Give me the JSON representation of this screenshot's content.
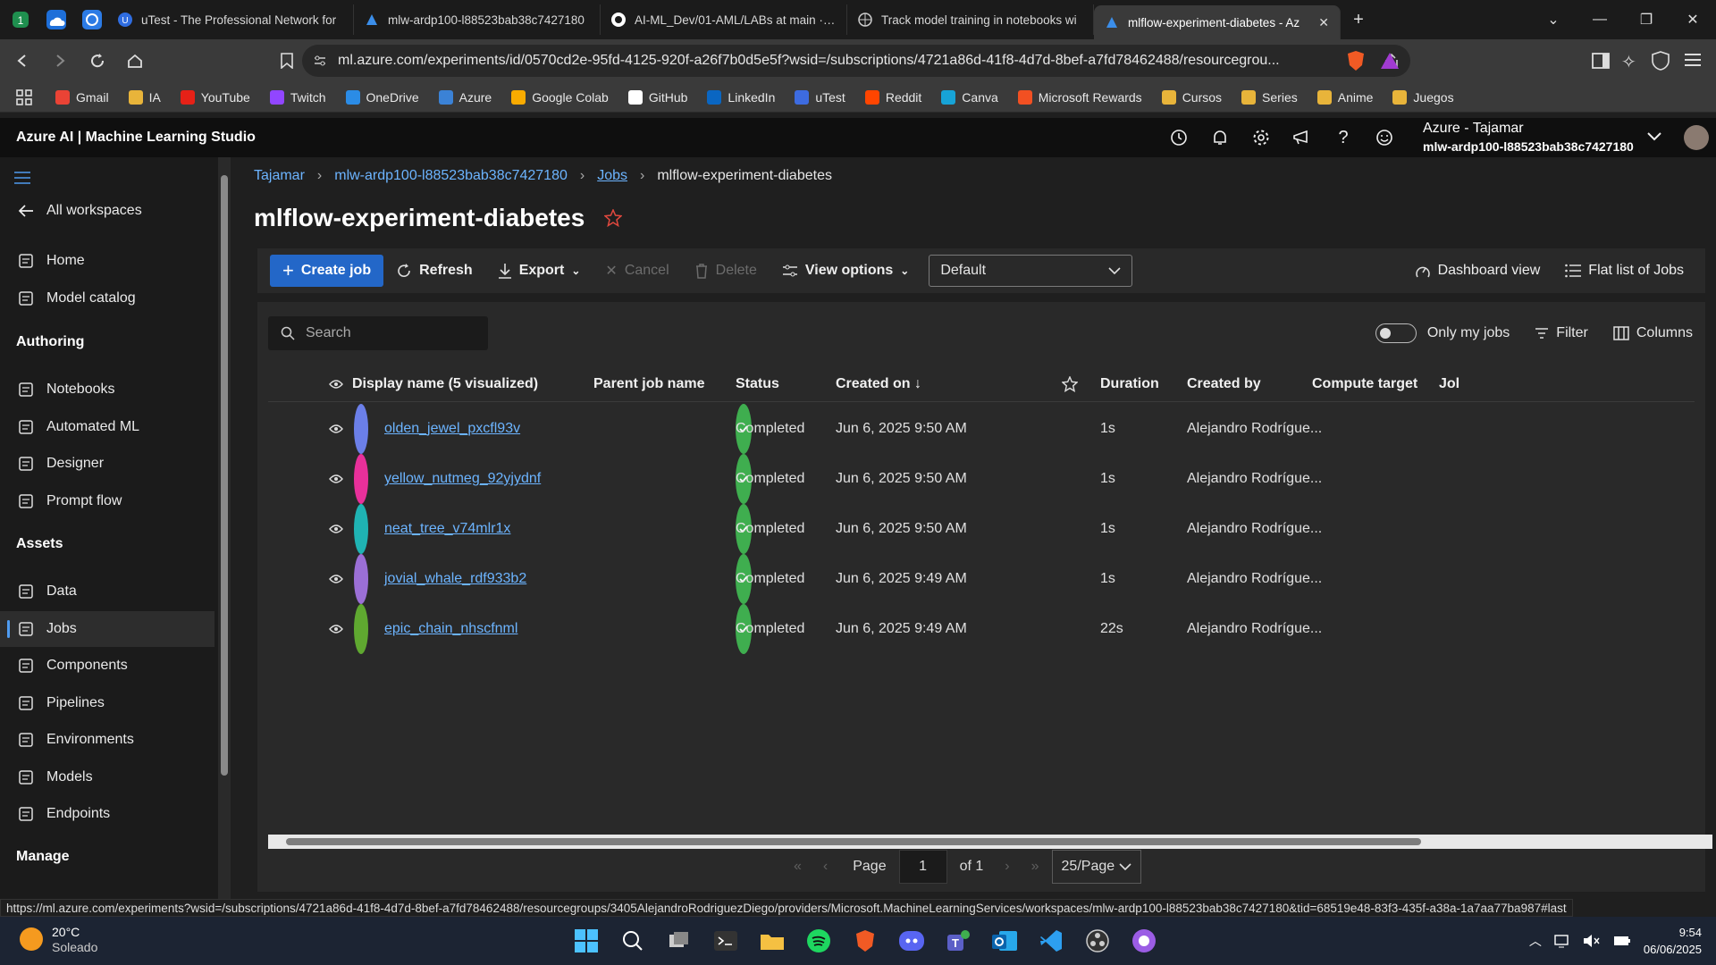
{
  "browser": {
    "tabs": [
      {
        "title": "uTest - The Professional Network for",
        "icon": "utest-icon"
      },
      {
        "title": "mlw-ardp100-l88523bab38c7427180",
        "icon": "azure-ml-icon"
      },
      {
        "title": "AI-ML_Dev/01-AML/LABs at main · al",
        "icon": "github-icon"
      },
      {
        "title": "Track model training in notebooks wi",
        "icon": "web-icon"
      },
      {
        "title": "mlflow-experiment-diabetes - Az",
        "icon": "azure-ml-icon"
      }
    ],
    "url": "ml.azure.com/experiments/id/0570cd2e-95fd-4125-920f-a26f7b0d5e5f?wsid=/subscriptions/4721a86d-41f8-4d7d-8bef-a7fd78462488/resourcegrou...",
    "bookmarks": [
      "Gmail",
      "IA",
      "YouTube",
      "Twitch",
      "OneDrive",
      "Azure",
      "Google Colab",
      "GitHub",
      "LinkedIn",
      "uTest",
      "Reddit",
      "Canva",
      "Microsoft Rewards",
      "Cursos",
      "Series",
      "Anime",
      "Juegos"
    ],
    "bookmark_colors": [
      "#ea4335",
      "#e8b43a",
      "#e62117",
      "#9146ff",
      "#2b8ce6",
      "#3b82d6",
      "#f9ab00",
      "#ffffff",
      "#0a66c2",
      "#3d6be0",
      "#ff4500",
      "#17a3d6",
      "#f25022",
      "#e8b43a",
      "#e8b43a",
      "#e8b43a",
      "#e8b43a"
    ],
    "status_url": "https://ml.azure.com/experiments?wsid=/subscriptions/4721a86d-41f8-4d7d-8bef-a7fd78462488/resourcegroups/3405AlejandroRodriguezDiego/providers/Microsoft.MachineLearningServices/workspaces/mlw-ardp100-l88523bab38c7427180&tid=68519e48-83f3-435f-a38a-1a7aa77ba987#last"
  },
  "app": {
    "brand": "Azure AI | Machine Learning Studio",
    "account_name": "Azure - Tajamar",
    "workspace": "mlw-ardp100-l88523bab38c7427180"
  },
  "sidebar": {
    "back": "All workspaces",
    "items_top": [
      {
        "label": "Home",
        "icon": "home-icon"
      },
      {
        "label": "Model catalog",
        "icon": "catalog-icon"
      }
    ],
    "section_authoring": "Authoring",
    "authoring": [
      {
        "label": "Notebooks",
        "icon": "notebook-icon"
      },
      {
        "label": "Automated ML",
        "icon": "automl-icon"
      },
      {
        "label": "Designer",
        "icon": "designer-icon"
      },
      {
        "label": "Prompt flow",
        "icon": "promptflow-icon"
      }
    ],
    "section_assets": "Assets",
    "assets": [
      {
        "label": "Data",
        "icon": "data-icon"
      },
      {
        "label": "Jobs",
        "icon": "jobs-icon"
      },
      {
        "label": "Components",
        "icon": "components-icon"
      },
      {
        "label": "Pipelines",
        "icon": "pipelines-icon"
      },
      {
        "label": "Environments",
        "icon": "environments-icon"
      },
      {
        "label": "Models",
        "icon": "models-icon"
      },
      {
        "label": "Endpoints",
        "icon": "endpoints-icon"
      }
    ],
    "section_manage": "Manage",
    "active": "Jobs"
  },
  "breadcrumb": [
    "Tajamar",
    "mlw-ardp100-l88523bab38c7427180",
    "Jobs",
    "mlflow-experiment-diabetes"
  ],
  "page_title": "mlflow-experiment-diabetes",
  "toolbar": {
    "create": "Create job",
    "refresh": "Refresh",
    "export": "Export",
    "cancel": "Cancel",
    "delete": "Delete",
    "view_options": "View options",
    "view_select": "Default",
    "dashboard": "Dashboard view",
    "flat_list": "Flat list of Jobs"
  },
  "grid": {
    "search_placeholder": "Search",
    "only_my_jobs": "Only my jobs",
    "filter": "Filter",
    "columns_btn": "Columns",
    "columns": [
      "Display name (5 visualized)",
      "Parent job name",
      "Status",
      "Created on ↓",
      "Duration",
      "Created by",
      "Compute target",
      "Jol"
    ],
    "rows": [
      {
        "name": "olden_jewel_pxcfl93v",
        "color": "#6b7fe8",
        "parent": "",
        "status": "Completed",
        "created": "Jun 6, 2025 9:50 AM",
        "duration": "1s",
        "by": "Alejandro Rodrígue...",
        "compute": ""
      },
      {
        "name": "yellow_nutmeg_92yjydnf",
        "color": "#e8309a",
        "parent": "",
        "status": "Completed",
        "created": "Jun 6, 2025 9:50 AM",
        "duration": "1s",
        "by": "Alejandro Rodrígue...",
        "compute": ""
      },
      {
        "name": "neat_tree_v74mlr1x",
        "color": "#1fb3b3",
        "parent": "",
        "status": "Completed",
        "created": "Jun 6, 2025 9:50 AM",
        "duration": "1s",
        "by": "Alejandro Rodrígue...",
        "compute": ""
      },
      {
        "name": "jovial_whale_rdf933b2",
        "color": "#9b6fd6",
        "parent": "",
        "status": "Completed",
        "created": "Jun 6, 2025 9:49 AM",
        "duration": "1s",
        "by": "Alejandro Rodrígue...",
        "compute": ""
      },
      {
        "name": "epic_chain_nhscfnml",
        "color": "#5fa830",
        "parent": "",
        "status": "Completed",
        "created": "Jun 6, 2025 9:49 AM",
        "duration": "22s",
        "by": "Alejandro Rodrígue...",
        "compute": ""
      }
    ]
  },
  "pager": {
    "page_label": "Page",
    "page": "1",
    "of": "of 1",
    "per_page": "25/Page"
  },
  "taskbar": {
    "temp": "20°C",
    "weather": "Soleado",
    "time": "9:54",
    "date": "06/06/2025"
  }
}
